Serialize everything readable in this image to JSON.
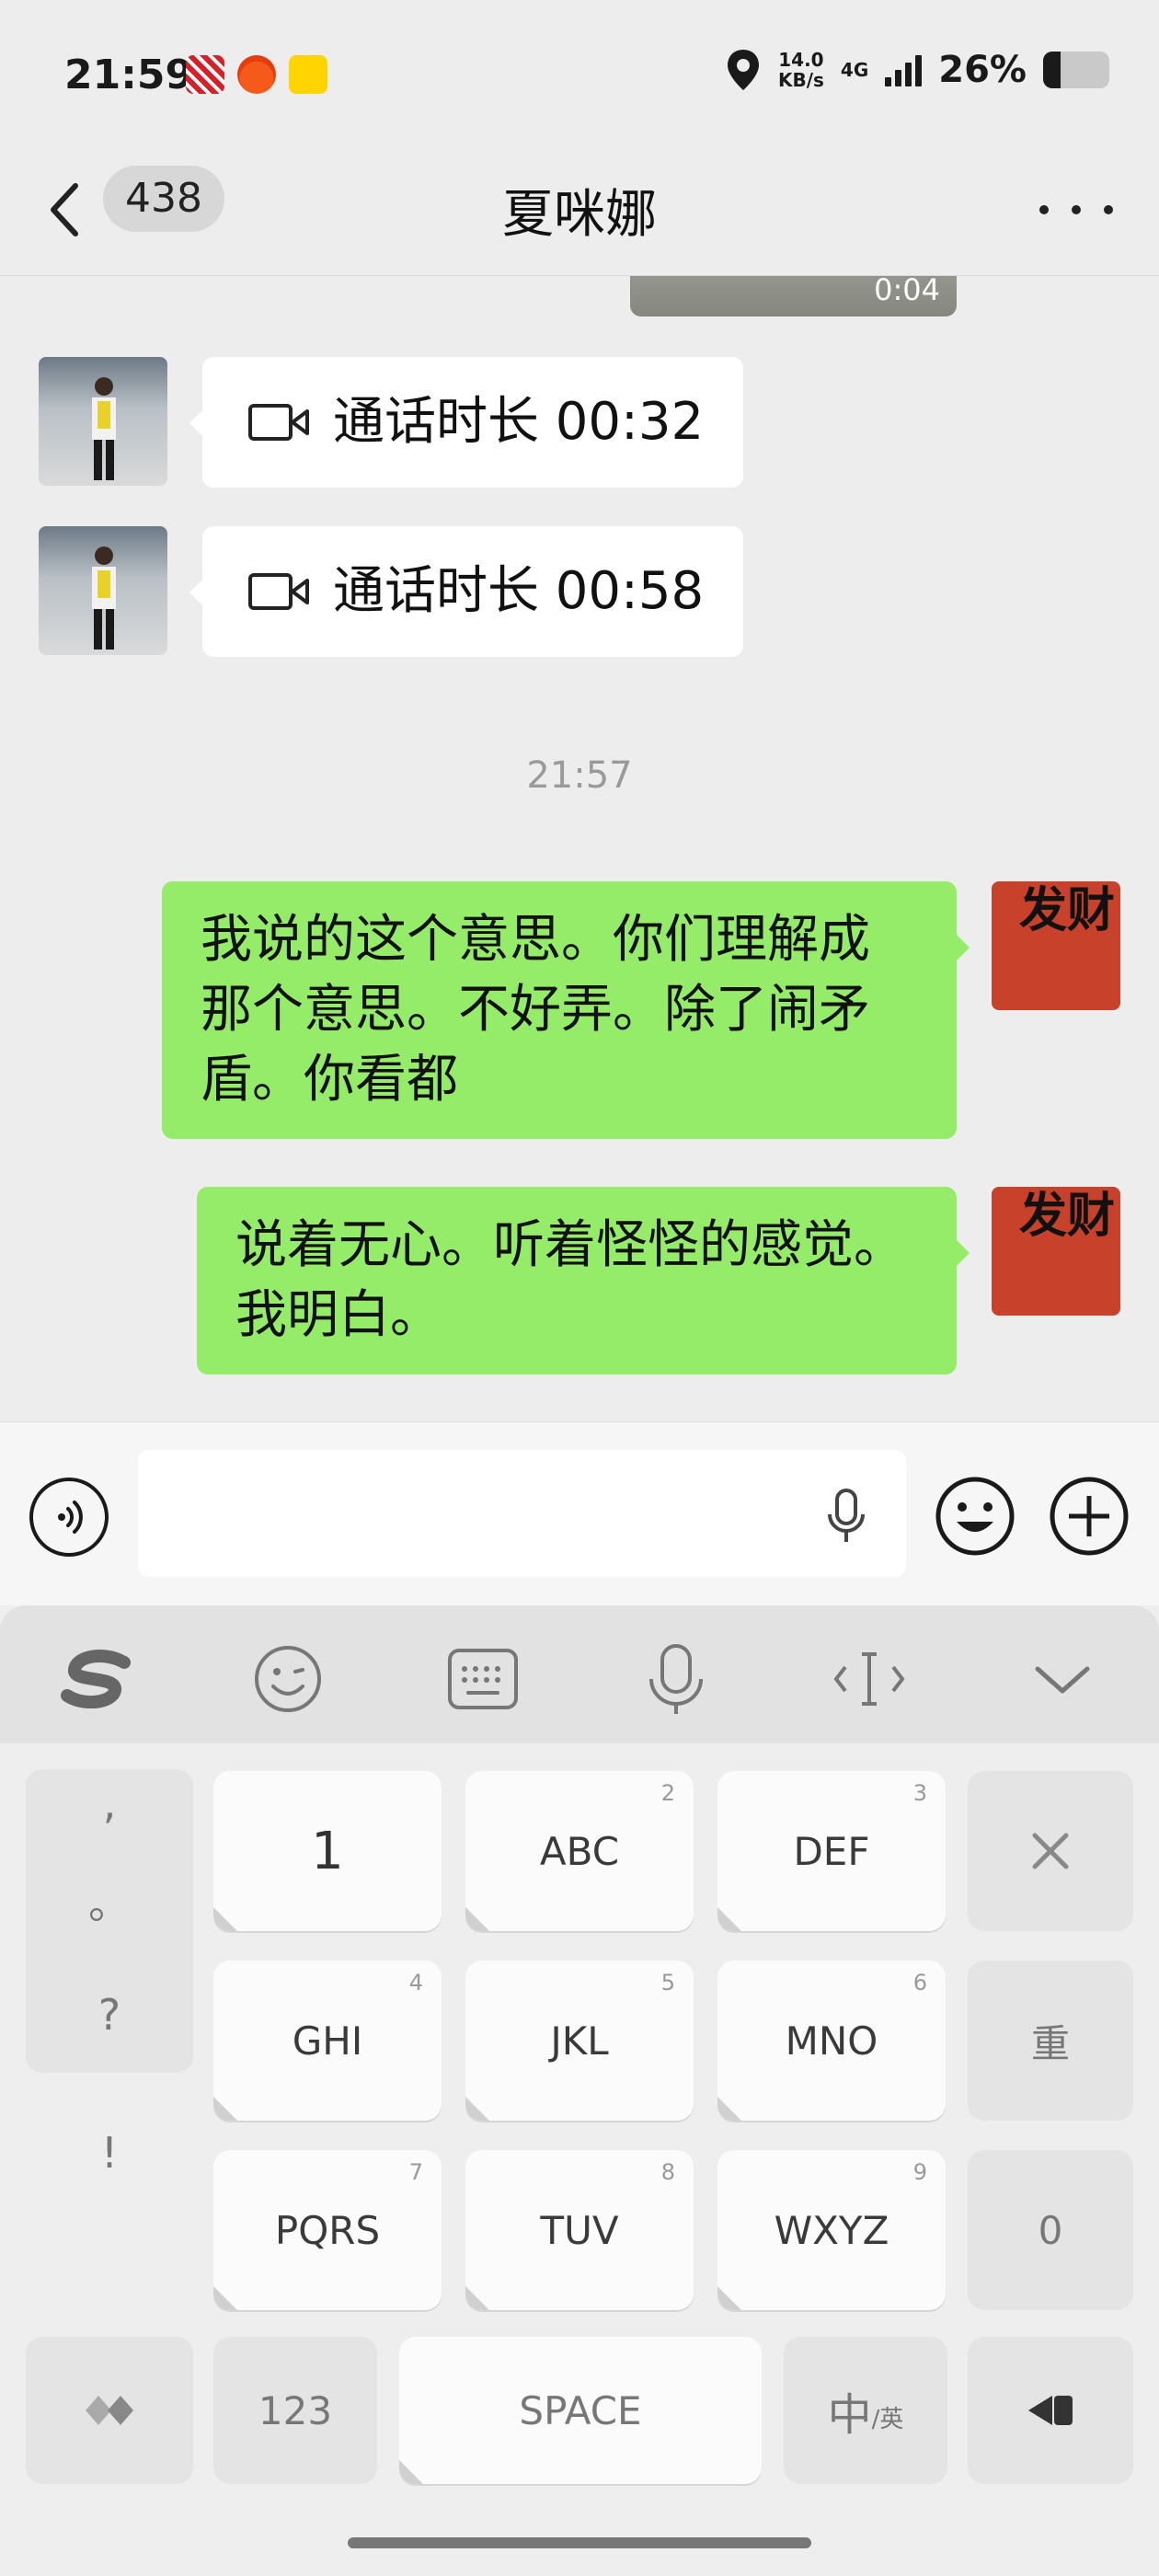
{
  "status_bar": {
    "time": "21:59",
    "net_speed_value": "14.0",
    "net_speed_unit": "KB/s",
    "network": "4G",
    "battery_percent": "26%",
    "battery_level": 0.26
  },
  "nav": {
    "unread_count": "438",
    "title": "夏咪娜"
  },
  "chat": {
    "video_duration": "0:04",
    "call_records": [
      {
        "text": "通话时长 00:32"
      },
      {
        "text": "通话时长 00:58"
      }
    ],
    "timestamp": "21:57",
    "sent_messages": [
      {
        "text": "我说的这个意思。你们理解成那个意思。不好弄。除了闹矛盾。你看都"
      },
      {
        "text": "说着无心。听着怪怪的感觉。我明白。"
      }
    ],
    "avatar_right_text": "发财"
  },
  "input": {
    "value": ""
  },
  "keyboard": {
    "punctuation": [
      ",",
      "。",
      "?",
      "!"
    ],
    "keys": {
      "k1": {
        "label": "1"
      },
      "k2": {
        "label": "ABC",
        "num": "2"
      },
      "k3": {
        "label": "DEF",
        "num": "3"
      },
      "k4": {
        "label": "GHI",
        "num": "4"
      },
      "k5": {
        "label": "JKL",
        "num": "5"
      },
      "k6": {
        "label": "MNO",
        "num": "6"
      },
      "k7": {
        "label": "PQRS",
        "num": "7"
      },
      "k8": {
        "label": "TUV",
        "num": "8"
      },
      "k9": {
        "label": "WXYZ",
        "num": "9"
      },
      "k0": {
        "label": "0"
      }
    },
    "reset_label": "重",
    "numbers_label": "123",
    "space_label": "SPACE",
    "lang_main": "中",
    "lang_sub": "/英"
  }
}
